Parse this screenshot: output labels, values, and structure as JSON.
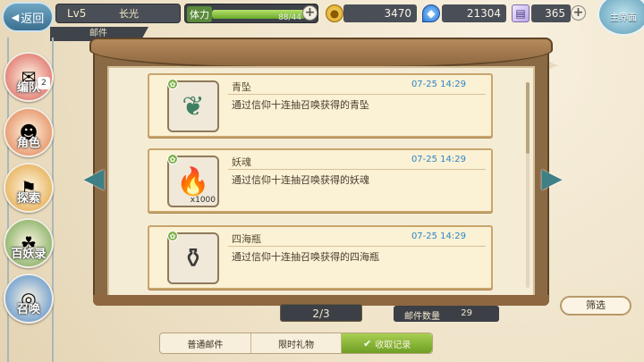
{
  "topbar": {
    "back_label": "返回",
    "level": "Lv5",
    "player_name": "长光",
    "stamina_label": "体力",
    "stamina_value": "88/44",
    "stamina_fraction": 1.0,
    "gold": "3470",
    "gems": "21304",
    "tickets": "365",
    "home_label": "主界面"
  },
  "page_tab": "邮件",
  "side_menu": [
    {
      "label": "编队",
      "icon": "formation-icon",
      "badge": "2",
      "color": "#d95a53"
    },
    {
      "label": "角色",
      "icon": "character-icon",
      "badge": "",
      "color": "#e07c4a"
    },
    {
      "label": "探索",
      "icon": "explore-icon",
      "badge": "",
      "color": "#e2a23a"
    },
    {
      "label": "百妖录",
      "icon": "monster-book-icon",
      "badge": "",
      "color": "#6da24a"
    },
    {
      "label": "召唤",
      "icon": "summon-icon",
      "badge": "",
      "color": "#4a88c9"
    }
  ],
  "mails": [
    {
      "title": "青坠",
      "time": "07-25 14:29",
      "desc": "通过信仰十连抽召唤获得的青坠",
      "qty": "",
      "icon": "pendant-icon"
    },
    {
      "title": "妖魂",
      "time": "07-25 14:29",
      "desc": "通过信仰十连抽召唤获得的妖魂",
      "qty": "x1000",
      "icon": "blue-soul-flame-icon"
    },
    {
      "title": "四海瓶",
      "time": "07-25 14:29",
      "desc": "通过信仰十连抽召唤获得的四海瓶",
      "qty": "",
      "icon": "sea-bottle-icon"
    }
  ],
  "pager": "2/3",
  "mail_count_label": "邮件数量",
  "mail_count": "29",
  "filter_label": "筛选",
  "tabs": [
    {
      "label": "普通邮件",
      "active": false
    },
    {
      "label": "限时礼物",
      "active": false
    },
    {
      "label": "收取记录",
      "active": true
    }
  ]
}
